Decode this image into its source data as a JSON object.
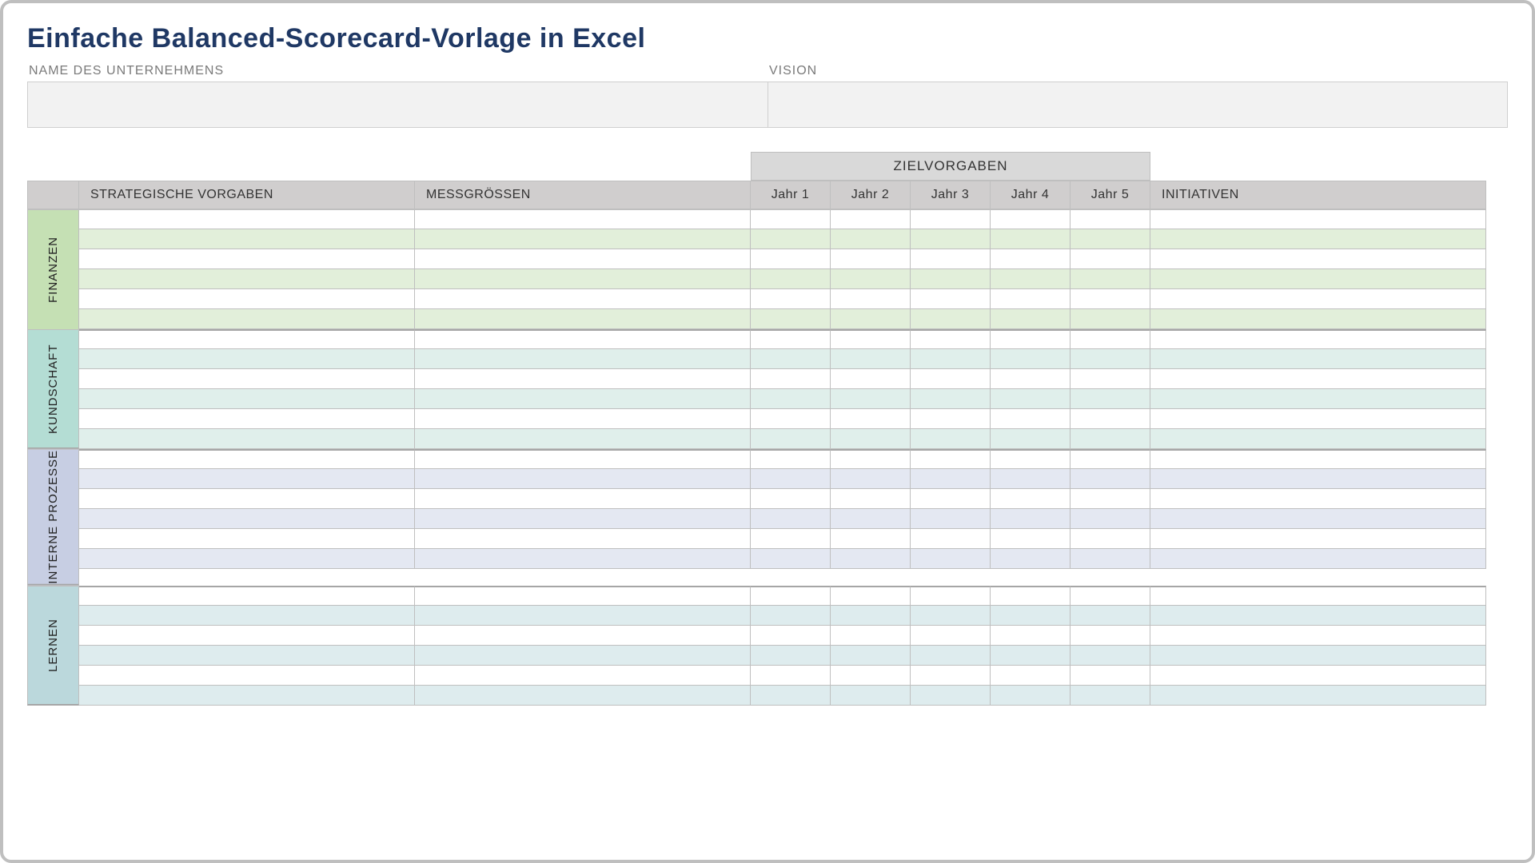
{
  "title": "Einfache Balanced-Scorecard-Vorlage in Excel",
  "meta": {
    "company_label": "NAME DES UNTERNEHMENS",
    "company_value": "",
    "vision_label": "VISION",
    "vision_value": ""
  },
  "headers": {
    "ziel": "ZIELVORGABEN",
    "strategic": "STRATEGISCHE VORGABEN",
    "measures": "MESSGRÖSSEN",
    "year1": "Jahr 1",
    "year2": "Jahr 2",
    "year3": "Jahr 3",
    "year4": "Jahr 4",
    "year5": "Jahr 5",
    "initiatives": "INITIATIVEN"
  },
  "sections": [
    {
      "key": "fin",
      "label": "FINANZEN",
      "rows": [
        {},
        {},
        {},
        {},
        {},
        {}
      ]
    },
    {
      "key": "kund",
      "label": "KUNDSCHAFT",
      "rows": [
        {},
        {},
        {},
        {},
        {},
        {}
      ]
    },
    {
      "key": "int",
      "label": "INTERNE PROZESSE",
      "rows": [
        {},
        {},
        {},
        {},
        {},
        {}
      ]
    },
    {
      "key": "lern",
      "label": "LERNEN",
      "rows": [
        {},
        {},
        {},
        {},
        {},
        {}
      ]
    }
  ]
}
